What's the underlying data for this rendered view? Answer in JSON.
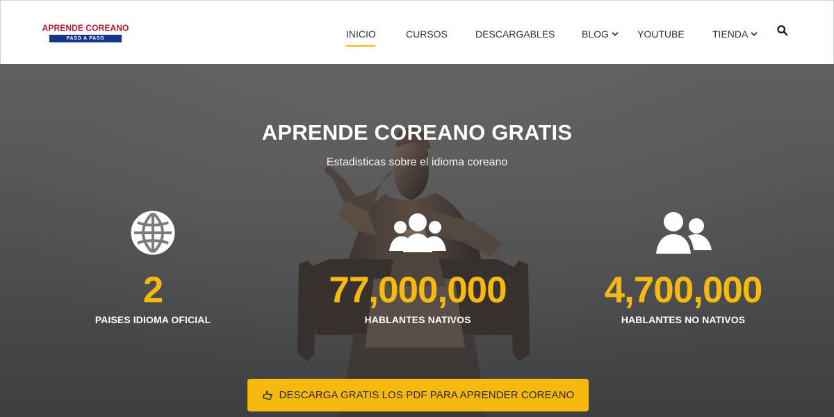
{
  "brand": {
    "logo_line_1": "APRENDE COREANO",
    "logo_line_2": "PASO A PASO",
    "colors": {
      "red": "#b31b34",
      "blue": "#16358a",
      "accent": "#f7b910"
    }
  },
  "header": {
    "nav": [
      {
        "label": "INICIO",
        "active": true
      },
      {
        "label": "CURSOS",
        "active": false
      },
      {
        "label": "DESCARGABLES",
        "active": false
      },
      {
        "label": "BLOG",
        "active": false,
        "icon": "chevron-down-icon"
      },
      {
        "label": "YOUTUBE",
        "active": false
      },
      {
        "label": "TIENDA",
        "active": false,
        "icon": "chevron-down-icon"
      }
    ],
    "search_icon": "search-icon"
  },
  "hero": {
    "title": "APRENDE COREANO GRATIS",
    "subtitle": "Estadisticas sobre el idioma coreano",
    "stats": [
      {
        "value": "2",
        "label": "PAISES IDIOMA OFICIAL",
        "icon": "globe-icon"
      },
      {
        "value": "77,000,000",
        "label": "HABLANTES NATIVOS",
        "icon": "group-icon"
      },
      {
        "value": "4,700,000",
        "label": "HABLANTES NO NATIVOS",
        "icon": "users-icon"
      }
    ],
    "cta": {
      "label": "DESCARGA GRATIS LOS PDF PARA APRENDER COREANO",
      "icon": "hand-pointing-icon"
    }
  }
}
